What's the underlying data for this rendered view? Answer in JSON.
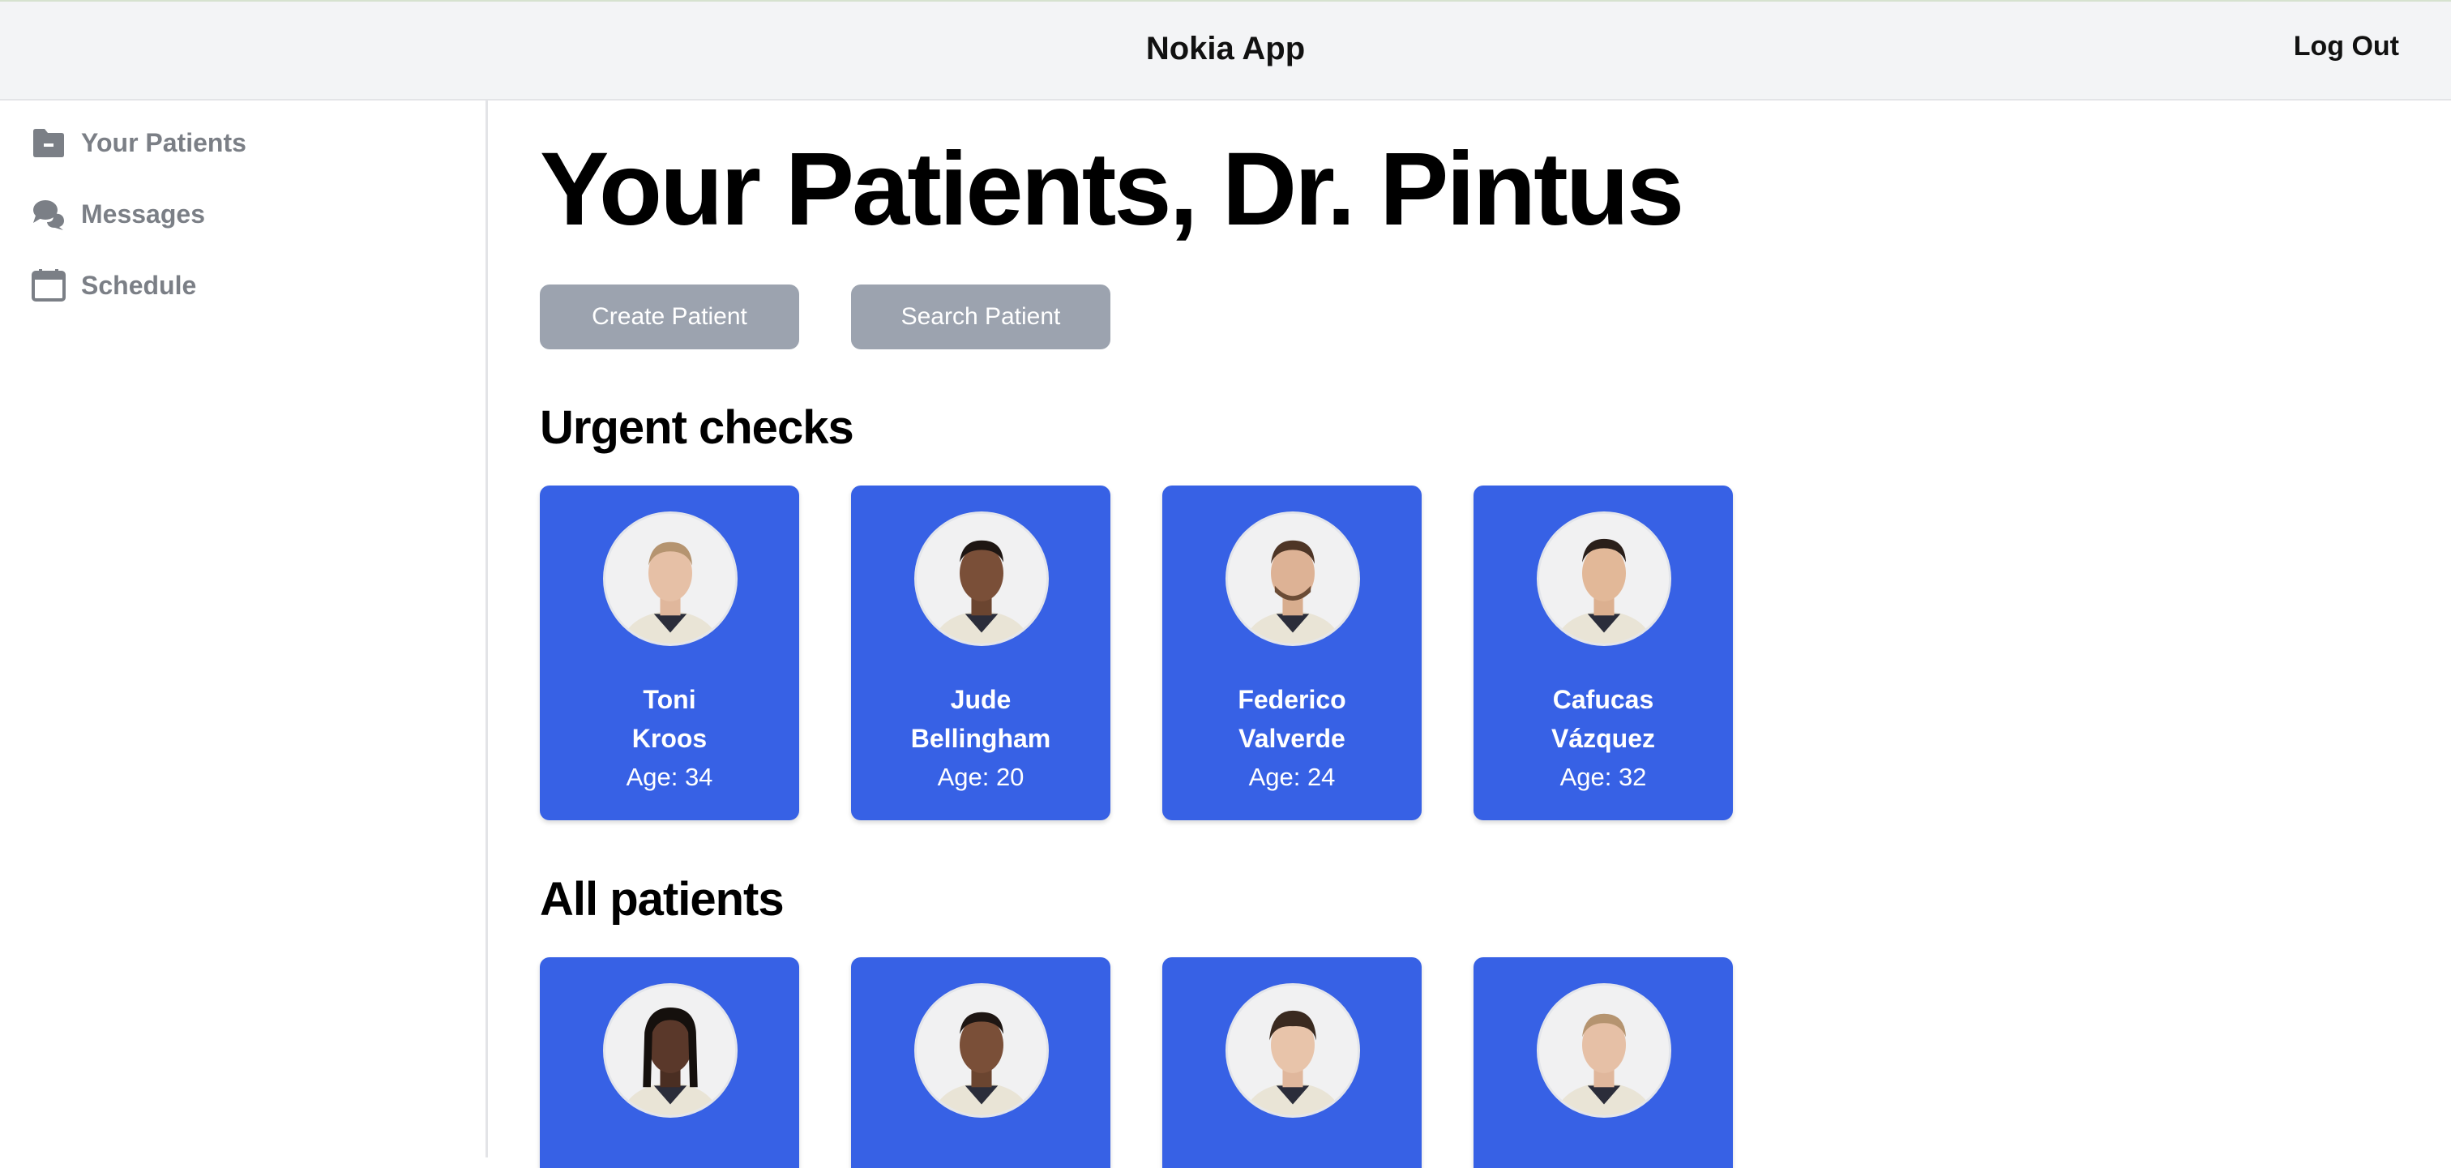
{
  "header": {
    "app_title": "Nokia App",
    "logout_label": "Log Out"
  },
  "sidebar": {
    "items": [
      {
        "label": "Your Patients",
        "icon": "folder-icon"
      },
      {
        "label": "Messages",
        "icon": "chat-bubbles-icon"
      },
      {
        "label": "Schedule",
        "icon": "calendar-icon"
      }
    ]
  },
  "main": {
    "title": "Your Patients, Dr. Pintus",
    "buttons": {
      "create": "Create Patient",
      "search": "Search Patient"
    },
    "urgent": {
      "title": "Urgent checks",
      "patients": [
        {
          "first": "Toni",
          "last": "Kroos",
          "age": "Age: 34"
        },
        {
          "first": "Jude",
          "last": "Bellingham",
          "age": "Age: 20"
        },
        {
          "first": "Federico",
          "last": "Valverde",
          "age": "Age: 24"
        },
        {
          "first": "Cafucas",
          "last": "Vázquez",
          "age": "Age: 32"
        }
      ]
    },
    "all": {
      "title": "All patients"
    }
  },
  "colors": {
    "card": "#3761e5",
    "button": "#9ca3af",
    "topbar": "#f3f4f6",
    "sidebar_text": "#7b7f86"
  }
}
